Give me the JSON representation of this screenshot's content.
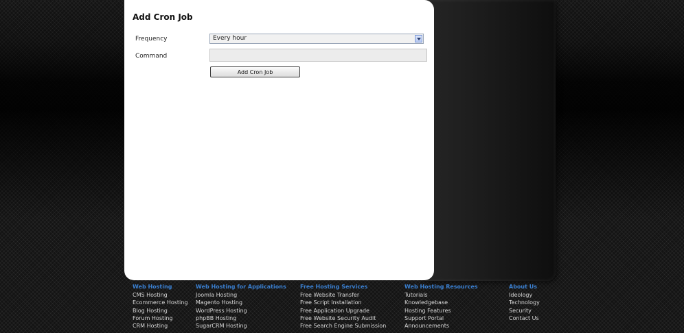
{
  "form": {
    "title": "Add Cron Job",
    "frequency_label": "Frequency",
    "frequency_value": "Every hour",
    "command_label": "Command",
    "command_value": "",
    "submit_label": "Add Cron Job"
  },
  "footer": {
    "col0": {
      "heading": "Web Hosting",
      "links": [
        "CMS Hosting",
        "Ecommerce Hosting",
        "Blog Hosting",
        "Forum Hosting",
        "CRM Hosting"
      ]
    },
    "col1": {
      "heading": "Web Hosting for Applications",
      "links": [
        "Joomla Hosting",
        "Magento Hosting",
        "WordPress Hosting",
        "phpBB Hosting",
        "SugarCRM Hosting"
      ]
    },
    "col2": {
      "heading": "Free Hosting Services",
      "links": [
        "Free Website Transfer",
        "Free Script Installation",
        "Free Application Upgrade",
        "Free Website Security Audit",
        "Free Search Engine Submission"
      ]
    },
    "col3": {
      "heading": "Web Hosting Resources",
      "links": [
        "Tutorials",
        "Knowledgebase",
        "Hosting Features",
        "Support Portal",
        "Announcements"
      ]
    },
    "col4": {
      "heading": "About Us",
      "links": [
        "Ideology",
        "Technology",
        "Security",
        "Contact Us"
      ]
    }
  },
  "colors": {
    "heading_blue": "#3a7fd0",
    "link_gray": "#d8d8d8",
    "panel_white": "#ffffff"
  },
  "icons": {
    "select_arrow": "chevron-down-icon"
  }
}
